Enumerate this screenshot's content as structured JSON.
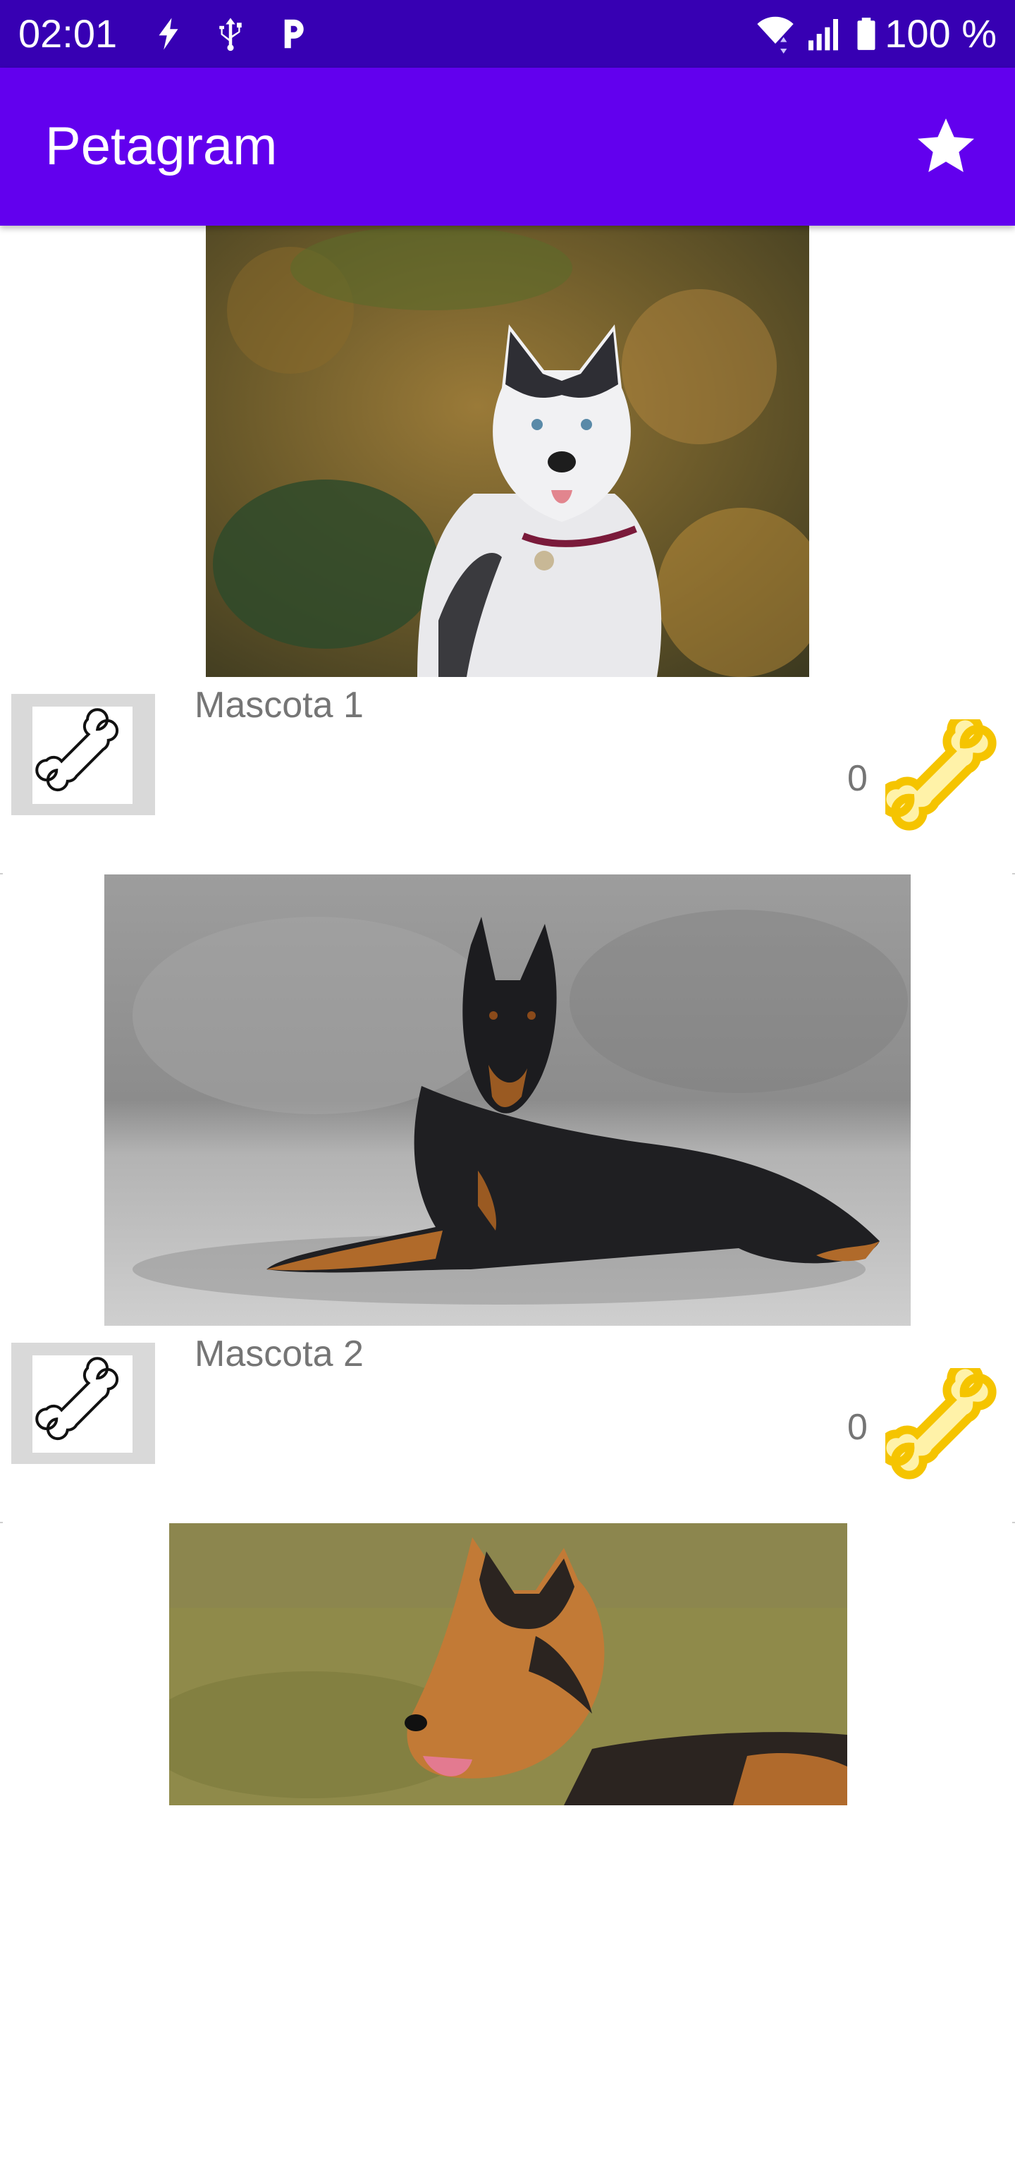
{
  "status_bar": {
    "time": "02:01",
    "battery": "100 %",
    "icons": [
      "flash-icon",
      "usb-icon",
      "parking-icon",
      "wifi-icon",
      "signal-icon",
      "battery-icon"
    ]
  },
  "app_bar": {
    "title": "Petagram",
    "action_icon": "star-icon"
  },
  "colors": {
    "status_bar": "#3700b3",
    "app_bar": "#6200ee",
    "bone_gold": "#f5c400",
    "text_gray": "#757575"
  },
  "pets": [
    {
      "name": "Mascota 1",
      "rating": "0",
      "photo": "husky-photo"
    },
    {
      "name": "Mascota 2",
      "rating": "0",
      "photo": "doberman-photo"
    },
    {
      "photo": "german-shepherd-photo"
    }
  ]
}
